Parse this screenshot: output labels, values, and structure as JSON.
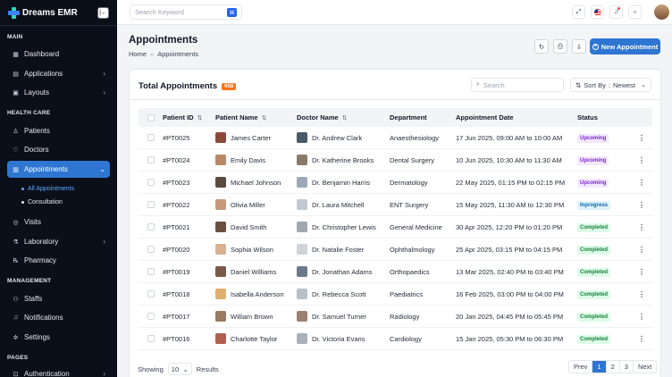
{
  "app": {
    "brand": "Dreams EMR",
    "search_placeholder": "Search Keyword"
  },
  "sidebar": {
    "sections": {
      "main": "MAIN",
      "healthcare": "HEALTH CARE",
      "management": "MANAGEMENT",
      "pages": "PAGES"
    },
    "items": {
      "dashboard": "Dashboard",
      "applications": "Applications",
      "layouts": "Layouts",
      "patients": "Patients",
      "doctors": "Doctors",
      "appointments": "Appointments",
      "all_appointments": "All Appointments",
      "consultation": "Consultation",
      "visits": "Visits",
      "laboratory": "Laboratory",
      "pharmacy": "Pharmacy",
      "staffs": "Staffs",
      "notifications": "Notifications",
      "settings": "Settings",
      "authentication": "Authentication"
    }
  },
  "page": {
    "title": "Appointments",
    "breadcrumb": [
      "Home",
      "Appointments"
    ],
    "new_button": "New Appointment"
  },
  "card": {
    "title": "Total Appointments",
    "count": "658",
    "search_placeholder": "Search",
    "sort_label": "Sort By",
    "sort_value": "Newest"
  },
  "table": {
    "headers": {
      "id": "Patient ID",
      "patient": "Patient Name",
      "doctor": "Doctor Name",
      "department": "Department",
      "date": "Appointment Date",
      "status": "Status"
    },
    "rows": [
      {
        "id": "#PT0025",
        "patient": "James Carter",
        "doctor": "Dr. Andrew Clark",
        "department": "Anaesthesiology",
        "date": "17 Jun 2025, 09:00 AM to 10:00 AM",
        "status": "Upcoming",
        "status_key": "upcoming"
      },
      {
        "id": "#PT0024",
        "patient": "Emily Davis",
        "doctor": "Dr. Katherine Brooks",
        "department": "Dental Surgery",
        "date": "10 Jun 2025, 10:30 AM to 11:30 AM",
        "status": "Upcoming",
        "status_key": "upcoming"
      },
      {
        "id": "#PT0023",
        "patient": "Michael Johnson",
        "doctor": "Dr. Benjamin Harris",
        "department": "Dermatology",
        "date": "22 May 2025, 01:15 PM to 02:15 PM",
        "status": "Upcoming",
        "status_key": "upcoming"
      },
      {
        "id": "#PT0022",
        "patient": "Olivia Miller",
        "doctor": "Dr. Laura Mitchell",
        "department": "ENT Surgery",
        "date": "15 May 2025, 11:30 AM to 12:30 PM",
        "status": "Inprogress",
        "status_key": "inprogress"
      },
      {
        "id": "#PT0021",
        "patient": "David Smith",
        "doctor": "Dr. Christopher Lewis",
        "department": "General Medicine",
        "date": "30 Apr 2025, 12:20 PM to 01:20 PM",
        "status": "Completed",
        "status_key": "completed"
      },
      {
        "id": "#PT0020",
        "patient": "Sophia Wilson",
        "doctor": "Dr. Natalie Foster",
        "department": "Ophthalmology",
        "date": "25 Apr 2025, 03:15 PM to 04:15 PM",
        "status": "Completed",
        "status_key": "completed"
      },
      {
        "id": "#PT0019",
        "patient": "Daniel Williams",
        "doctor": "Dr. Jonathan Adams",
        "department": "Orthopaedics",
        "date": "13 Mar 2025, 02:40 PM to 03:40 PM",
        "status": "Completed",
        "status_key": "completed"
      },
      {
        "id": "#PT0018",
        "patient": "Isabella Anderson",
        "doctor": "Dr. Rebecca Scott",
        "department": "Paediatrics",
        "date": "16 Feb 2025, 03:00 PM to 04:00 PM",
        "status": "Completed",
        "status_key": "completed"
      },
      {
        "id": "#PT0017",
        "patient": "William Brown",
        "doctor": "Dr. Samuel Turner",
        "department": "Radiology",
        "date": "20 Jan 2025, 04:45 PM to 05:45 PM",
        "status": "Completed",
        "status_key": "completed"
      },
      {
        "id": "#PT0016",
        "patient": "Charlotte Taylor",
        "doctor": "Dr. Victoria Evans",
        "department": "Cardiology",
        "date": "15 Jan 2025, 05:30 PM to 06:30 PM",
        "status": "Completed",
        "status_key": "completed"
      }
    ]
  },
  "footer": {
    "showing": "Showing",
    "page_size": "10",
    "results": "Results",
    "pages": [
      "Prev",
      "1",
      "2",
      "3",
      "Next"
    ]
  },
  "colors": {
    "accent": "#2e76d1",
    "sidebar_bg": "#0b0f19",
    "count_badge": "#f97316"
  }
}
